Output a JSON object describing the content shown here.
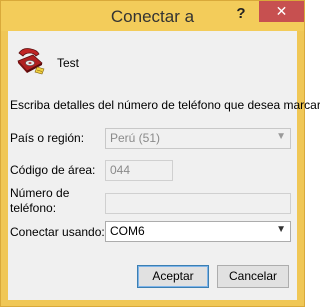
{
  "window": {
    "title": "Conectar a",
    "help_label": "?",
    "close_label": "✕"
  },
  "connection": {
    "name": "Test",
    "icon": "telephone-icon"
  },
  "instruction": "Escriba detalles del número de teléfono que desea marcar:",
  "fields": {
    "country": {
      "label": "País o región:",
      "value": "Perú (51)"
    },
    "area_code": {
      "label": "Código de área:",
      "value": "044"
    },
    "phone_number": {
      "label_line1": "Número de",
      "label_line2": "teléfono:",
      "value": ""
    },
    "connect_using": {
      "label": "Conectar usando:",
      "value": "COM6"
    }
  },
  "buttons": {
    "accept": "Aceptar",
    "cancel": "Cancelar"
  },
  "colors": {
    "frame": "#f0c756",
    "close_button": "#c75050",
    "client_bg": "#f0f0f0"
  }
}
